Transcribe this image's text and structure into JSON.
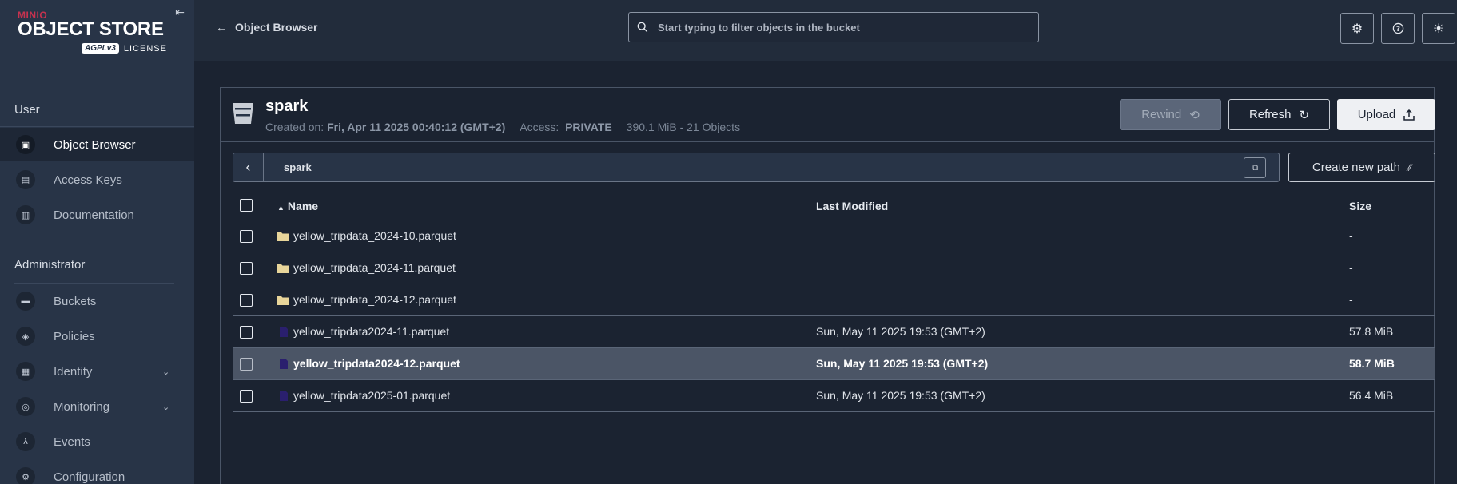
{
  "sidebar": {
    "brand": "MINIO",
    "product": "OBJECT STORE",
    "agpl": "AGPLv3",
    "license": "LICENSE",
    "user_section": "User",
    "admin_section": "Administrator",
    "user_items": [
      {
        "label": "Object Browser",
        "icon": "object-browser-icon"
      },
      {
        "label": "Access Keys",
        "icon": "access-keys-icon"
      },
      {
        "label": "Documentation",
        "icon": "documentation-icon"
      }
    ],
    "admin_items": [
      {
        "label": "Buckets",
        "icon": "buckets-icon"
      },
      {
        "label": "Policies",
        "icon": "policies-icon"
      },
      {
        "label": "Identity",
        "icon": "identity-icon"
      },
      {
        "label": "Monitoring",
        "icon": "monitoring-icon"
      },
      {
        "label": "Events",
        "icon": "lambda-icon"
      },
      {
        "label": "Configuration",
        "icon": "configuration-icon"
      }
    ]
  },
  "header": {
    "back_label": "Object Browser",
    "search_placeholder": "Start typing to filter objects in the bucket"
  },
  "bucket": {
    "name": "spark",
    "created_label": "Created on:",
    "created_value": "Fri, Apr 11 2025 00:40:12 (GMT+2)",
    "access_label": "Access:",
    "access_value": "PRIVATE",
    "summary": "390.1 MiB - 21 Objects",
    "rewind_label": "Rewind",
    "refresh_label": "Refresh",
    "upload_label": "Upload",
    "path": "spark",
    "new_path_label": "Create new path"
  },
  "table": {
    "columns": {
      "name": "Name",
      "modified": "Last Modified",
      "size": "Size"
    },
    "rows": [
      {
        "name": "yellow_tripdata_2024-10.parquet",
        "type": "folder",
        "modified": "",
        "size": "-"
      },
      {
        "name": "yellow_tripdata_2024-11.parquet",
        "type": "folder",
        "modified": "",
        "size": "-"
      },
      {
        "name": "yellow_tripdata_2024-12.parquet",
        "type": "folder",
        "modified": "",
        "size": "-"
      },
      {
        "name": "yellow_tripdata2024-11.parquet",
        "type": "file",
        "modified": "Sun, May 11 2025 19:53 (GMT+2)",
        "size": "57.8 MiB"
      },
      {
        "name": "yellow_tripdata2024-12.parquet",
        "type": "file",
        "modified": "Sun, May 11 2025 19:53 (GMT+2)",
        "size": "58.7 MiB",
        "selected": true
      },
      {
        "name": "yellow_tripdata2025-01.parquet",
        "type": "file",
        "modified": "Sun, May 11 2025 19:53 (GMT+2)",
        "size": "56.4 MiB"
      }
    ]
  },
  "colors": {
    "brand_red": "#c8324f",
    "folder": "#e8d59a",
    "file": "#2a1f6e"
  }
}
